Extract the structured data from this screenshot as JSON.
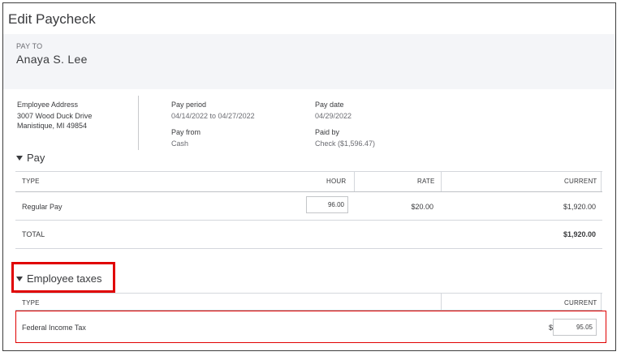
{
  "dialog": {
    "title": "Edit Paycheck"
  },
  "pay_to": {
    "label": "PAY TO",
    "name": "Anaya S. Lee"
  },
  "employee_address": {
    "label": "Employee Address",
    "line1": "3007 Wood Duck Drive",
    "line2": "Manistique, MI 49854"
  },
  "pay_period": {
    "label": "Pay period",
    "value": "04/14/2022 to 04/27/2022"
  },
  "pay_from": {
    "label": "Pay from",
    "value": "Cash"
  },
  "pay_date": {
    "label": "Pay date",
    "value": "04/29/2022"
  },
  "paid_by": {
    "label": "Paid by",
    "value": "Check ($1,596.47)"
  },
  "pay_section": {
    "title": "Pay",
    "columns": {
      "type": "TYPE",
      "hour": "HOUR",
      "rate": "RATE",
      "current": "CURRENT"
    },
    "rows": [
      {
        "type": "Regular Pay",
        "hour": "96.00",
        "rate": "$20.00",
        "current": "$1,920.00"
      }
    ],
    "total": {
      "label": "TOTAL",
      "current": "$1,920.00"
    }
  },
  "employee_taxes": {
    "title": "Employee taxes",
    "columns": {
      "type": "TYPE",
      "current": "CURRENT"
    },
    "rows": [
      {
        "type": "Federal Income Tax",
        "currency": "$",
        "current": "95.05"
      }
    ]
  },
  "colors": {
    "highlight": "#e00000",
    "header_band": "#f4f5f8",
    "text": "#393a3d"
  },
  "icons": {
    "collapse": "triangle-down-icon"
  }
}
